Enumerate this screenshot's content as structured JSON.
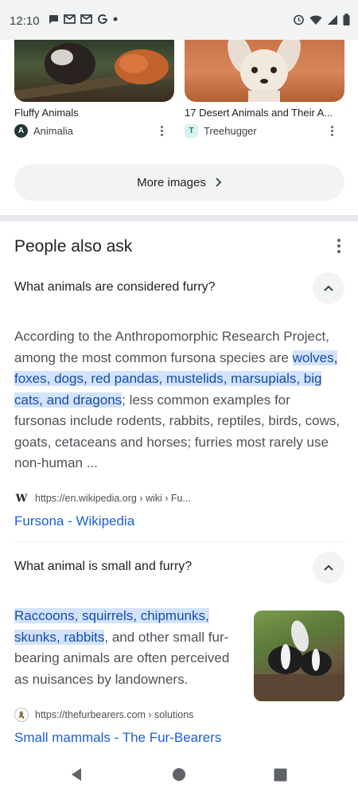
{
  "status_bar": {
    "time": "12:10",
    "left_icons": [
      "chat-icon",
      "gmail-icon",
      "gmail-icon",
      "google-icon",
      "dot-icon"
    ],
    "right_icons": [
      "alarm-icon",
      "wifi-icon",
      "signal-icon",
      "battery-icon"
    ]
  },
  "images": [
    {
      "title": "Fluffy Animals",
      "source": "Animalia",
      "source_icon_letter": "A"
    },
    {
      "title": "17 Desert Animals and Their A...",
      "source": "Treehugger",
      "source_icon_letter": "T"
    }
  ],
  "more_images": {
    "label": "More images"
  },
  "people_also_ask": {
    "title": "People also ask",
    "questions": [
      {
        "question": "What animals are considered furry?",
        "answer_pre": "According to the Anthropomorphic Research Project, among the most common fursona species are ",
        "answer_highlight": "wolves, foxes, dogs, red pandas, mustelids, marsupials, big cats, and dragons",
        "answer_post": "; less common examples for fursonas include rodents, rabbits, reptiles, birds, cows, goats, cetaceans and horses; furries most rarely use non-human ...",
        "source_url": "https://en.wikipedia.org › wiki › Fu...",
        "link_title": "Fursona - Wikipedia"
      },
      {
        "question": "What animal is small and furry?",
        "answer_pre": "",
        "answer_highlight": "Raccoons, squirrels, chipmunks, skunks, rabbits",
        "answer_post": ", and other small fur-bearing animals are often perceived as nuisances by landowners.",
        "source_url": "https://thefurbearers.com › solutions",
        "link_title": "Small mammals - The Fur-Bearers"
      }
    ]
  },
  "colors": {
    "link": "#1a5fd8",
    "highlight_bg": "#d3e3fd",
    "highlight_text": "#174ea6"
  }
}
